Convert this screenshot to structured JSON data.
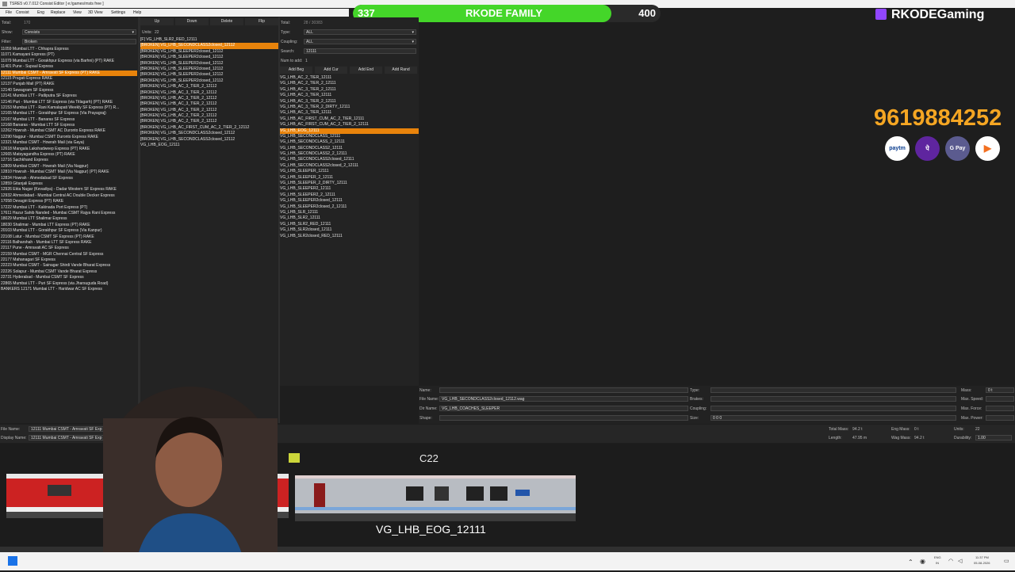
{
  "window": {
    "title": "TSRE5 v0.7.012 Consist Editor [ e:/games/msts free ]"
  },
  "menu": [
    "File",
    "Consist",
    "Eng",
    "Replace",
    "View",
    "3D View",
    "Settings",
    "Help"
  ],
  "overlay": {
    "left_count": "337",
    "right_count": "400",
    "label": "RKODE FAMILY",
    "progress_fraction": 0.84
  },
  "brand": {
    "channel": "RKODEGaming",
    "phone": "9619884252",
    "pay_icons": [
      "paytm-icon",
      "phonepe-icon",
      "gpay-icon",
      "bhim-icon"
    ],
    "pay_labels": [
      "paytm",
      "पे",
      "G Pay",
      "▶"
    ]
  },
  "left_panel": {
    "total_label": "Total:",
    "total_value": "170",
    "show_label": "Show:",
    "show_value": "Consists",
    "filter_label": "Filter:",
    "filter_value": "Broken",
    "items": [
      "11059 Mumbai LTT - Chhapra Express",
      "11071 Kamayani Express (PT)",
      "11079 Mumbai LTT - Gorakhpur Express (via Barhni) (PT) RAKE",
      "11401 Pune - Supaul Express",
      "12111 Mumbai CSMT - Amravati SF Express (PT) RAKE",
      "12115 Pragati Express RAKE",
      "12137 Punjab Mail (PT) RAKE",
      "12140 Sewagram SF Express",
      "12141 Mumbai LTT - Patliputra SF Express",
      "12146 Puri - Mumbai LTT SF Express (via Titlagarh) (PT) RAKE",
      "12153 Mumbai LTT - Rani Kamalapati Weekly SF Express (PT) R...",
      "12165 Mumbai LTT - Gorakhpur SF Express (Via Prayagraj)",
      "12167 Mumbai LTT - Banaras SF Express",
      "12168 Banaras - Mumbai LTT SF Express",
      "12262 Howrah - Mumbai CSMT AC Duronto Express RAKE",
      "12290 Nagpur - Mumbai CSMT Duronto Express RAKE",
      "12321 Mumbai CSMT - Howrah Mail (via Gaya)",
      "12618 Mangala Lakshadweep Express (PT) RAKE",
      "12665 Matsyagandha Express (PT) RAKE",
      "12716 Sachkhand Express",
      "12809 Mumbai CSMT - Howrah Mail (Via Nagpur)",
      "12810 Howrah - Mumbai CSMT Mail (Via Nagpur) (PT) RAKE",
      "12834 Howrah - Ahmedabad SF Express",
      "12859 Gitanjali Express",
      "12926 Ekta Nagar (Kevadiya) - Dadar Western SF Express RAKE",
      "12932 Ahmedabad - Mumbai Central AC Double Decker Express",
      "17058 Devagiri Express (PT) RAKE",
      "17222 Mumbai LTT - Kakinada Port Express (PT)",
      "17611 Hazur Sahib Nanded - Mumbai CSMT Rajya Rani Express",
      "18029 Mumbai LTT Shalimar Express",
      "18030 Shalimar - Mumbai LTT Express (PT) RAKE",
      "20103 Mumbai LTT - Gorakhpur SF Express (Via Kanpur)",
      "22108 Latur - Mumbai CSMT SF Express (PT) RAKE",
      "22116 Balharshah - Mumbai LTT SF Express RAKE",
      "22117 Pune - Amravati AC SF Express",
      "22159 Mumbai CSMT - MGR Chennai Central SF Express",
      "22177 Mahanagari SF Express",
      "22223 Mumbai CSMT - Sainagar Shirdi Vande Bharat Express",
      "22226 Solapur - Mumbai CSMT Vande Bharat Express",
      "22731 Hyderabad - Mumbai CSMT SF Express",
      "22865 Mumbai LTT - Puri SF Express (via Jharsuguda Road)",
      "BANKERS 12171 Mumbai LTT - Haridwar AC SF Express"
    ],
    "selected_index": 4
  },
  "middle_panel": {
    "buttons": [
      "Up",
      "Down",
      "Delete",
      "Flip"
    ],
    "units_label": "Units:",
    "units_value": "22",
    "items": [
      "[F] VG_LHB_SLR2_RED_12111",
      "[BROKEN] VG_LHB_SECONDCLASS2closed_12112",
      "[BROKEN] VG_LHB_SLEEPER2closed_12112",
      "[BROKEN] VG_LHB_SLEEPER2closed_12112",
      "[BROKEN] VG_LHB_SLEEPER2closed_12112",
      "[BROKEN] VG_LHB_SLEEPER2closed_12112",
      "[BROKEN] VG_LHB_SLEEPER2closed_12112",
      "[BROKEN] VG_LHB_SLEEPER2closed_12112",
      "[BROKEN] VG_LHB_AC_3_TIER_2_12112",
      "[BROKEN] VG_LHB_AC_3_TIER_2_12112",
      "[BROKEN] VG_LHB_AC_3_TIER_2_12112",
      "[BROKEN] VG_LHB_AC_3_TIER_2_12112",
      "[BROKEN] VG_LHB_AC_3_TIER_2_12112",
      "[BROKEN] VG_LHB_AC_2_TIER_2_12112",
      "[BROKEN] VG_LHB_AC_2_TIER_2_12112",
      "[BROKEN] VG_LHB_AC_FIRST_CUM_AC_2_TIER_2_12112",
      "[BROKEN] VG_LHB_SECONDCLASS2closed_12112",
      "[BROKEN] VG_LHB_SECONDCLASS2closed_12112",
      "VG_LHB_EOG_12111"
    ],
    "selected_index": 1
  },
  "right_panel": {
    "total_label": "Total:",
    "total_value": "28 / 30383",
    "type_label": "Type:",
    "type_value": "ALL",
    "coupling_label": "Coupling:",
    "coupling_value": "ALL",
    "search_label": "Search:",
    "search_value": "12111",
    "num_label": "Num to add:",
    "num_value": "1",
    "buttons": [
      "Add Beg",
      "Add Cur",
      "Add End",
      "Add Rand"
    ],
    "items": [
      "VG_LHB_AC_2_TIER_12111",
      "VG_LHB_AC_2_TIER_2_12111",
      "VG_LHB_AC_3_TIER_2_12111",
      "VG_LHB_AC_3_TIER_12111",
      "VG_LHB_AC_3_TIER_2_12111",
      "VG_LHB_AC_3_TIER_2_DIRTY_12111",
      "VG_LHB_AC_3_TIER_12111",
      "VG_LHB_AC_FIRST_CUM_AC_2_TIER_12111",
      "VG_LHB_AC_FIRST_CUM_AC_2_TIER_2_12111",
      "VG_LHB_EOG_12111",
      "VG_LHB_SECONDCLASS_12111",
      "VG_LHB_SECONDCLASS_2_12111",
      "VG_LHB_SECONDCLASS2_12111",
      "VG_LHB_SECONDCLASS2_2_12111",
      "VG_LHB_SECONDCLASS2closed_12111",
      "VG_LHB_SECONDCLASS2closed_2_12111",
      "VG_LHB_SLEEPER_12111",
      "VG_LHB_SLEEPER_2_12111",
      "VG_LHB_SLEEPER_2_DIRTY_12111",
      "VG_LHB_SLEEPER2_12111",
      "VG_LHB_SLEEPER2_2_12111",
      "VG_LHB_SLEEPER2closed_12111",
      "VG_LHB_SLEEPER2closed_2_12111",
      "VG_LHB_SLR_12111",
      "VG_LHB_SLR2_12111",
      "VG_LHB_SLR2_RED_12111",
      "VG_LHB_SLR2closed_12111",
      "VG_LHB_SLR2closed_RED_12111"
    ],
    "selected_index": 9
  },
  "info": {
    "name_label": "Name:",
    "name_value": "",
    "file_label": "File Name:",
    "file_value": "VG_LHB_SECONDCLASS2closed_12112.wag",
    "dir_label": "Dir Name:",
    "dir_value": "VG_LHB_COACHES_SLEEPER",
    "shape_label": "Shape:",
    "shape_value": "",
    "type_label": "Type:",
    "brakes_label": "Brakes:",
    "coupling_label": "Coupling:",
    "size_label": "Size:",
    "size_value": "0 0 0",
    "mass_label": "Mass:",
    "mass_value": "0 t",
    "speed_label": "Max. Speed:",
    "force_label": "Max. Force:",
    "power_label": "Max. Power:"
  },
  "bottom_bar": {
    "file_label": "File Name:",
    "file_value": "12111 Mumbai CSMT - Amravati SF Exp",
    "display_label": "Display Name:",
    "display_value": "12111 Mumbai CSMT - Amravati SF Exp",
    "total_mass_label": "Total Mass:",
    "total_mass_value": "94.2 t",
    "eng_mass_label": "Eng Mass:",
    "eng_mass_value": "0 t",
    "units_label": "Units:",
    "units_value": "22",
    "length_label": "Length:",
    "length_value": "47.95 m",
    "wag_mass_label": "Wag Mass:",
    "wag_mass_value": "94.2 t",
    "dur_label": "Durability:",
    "dur_value": "1.00"
  },
  "viewer": {
    "coach_caption": "VG_LHB_EOG_12111",
    "coach_number": "C22"
  },
  "taskbar": {
    "lang_top": "ENG",
    "lang_bottom": "IN",
    "time": "11:37 PM",
    "date": "05-08-2026"
  }
}
